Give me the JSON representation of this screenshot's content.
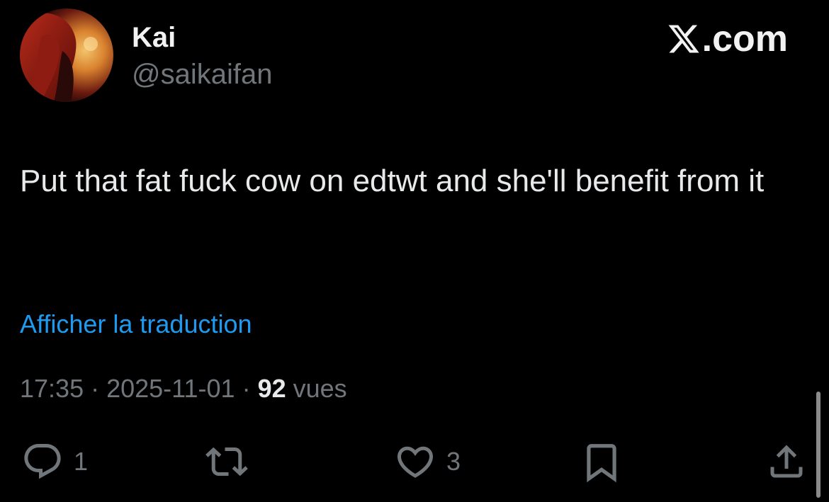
{
  "author": {
    "display_name": "Kai",
    "handle": "@saikaifan"
  },
  "brand": {
    "label": ".com",
    "icon": "x-logo-icon"
  },
  "tweet": {
    "text": "Put that fat fuck cow on edtwt and she'll benefit from it",
    "translate_label": "Afficher la traduction",
    "time": "17:35",
    "separator": " · ",
    "date": "2025-11-01",
    "views_count": "92",
    "views_label": " vues"
  },
  "actions": {
    "reply": {
      "icon": "reply-icon",
      "count": "1"
    },
    "retweet": {
      "icon": "retweet-icon",
      "count": ""
    },
    "like": {
      "icon": "heart-icon",
      "count": "3"
    },
    "bookmark": {
      "icon": "bookmark-icon",
      "count": ""
    },
    "share": {
      "icon": "share-icon",
      "count": ""
    }
  },
  "colors": {
    "background": "#000000",
    "link": "#1d9bf0",
    "secondary_text": "#71767b",
    "primary_text": "#e7e9ea"
  }
}
